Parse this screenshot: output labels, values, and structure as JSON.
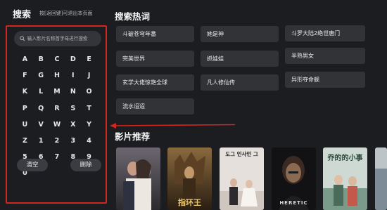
{
  "search": {
    "title": "搜索",
    "hint": "按[返回键]可退出本页面",
    "placeholder": "输入影片名称首字母进行搜索",
    "keys": [
      "A",
      "B",
      "C",
      "D",
      "E",
      "F",
      "G",
      "H",
      "I",
      "J",
      "K",
      "L",
      "M",
      "N",
      "O",
      "P",
      "Q",
      "R",
      "S",
      "T",
      "U",
      "V",
      "W",
      "X",
      "Y",
      "Z",
      "1",
      "2",
      "3",
      "4",
      "5",
      "6",
      "7",
      "8",
      "9",
      "0"
    ],
    "clear_label": "清空",
    "delete_label": "删除"
  },
  "hot": {
    "title": "搜索热词",
    "items": [
      "斗破苍穹年番",
      "她是神",
      "斗罗大陆2绝世唐门",
      "完美世界",
      "抓娃娃",
      "半熟男女",
      "玄学大佬惊艳全球",
      "凡人修仙传",
      "异形夺命舰",
      "流水迢迢"
    ]
  },
  "recommend": {
    "title": "影片推荐",
    "posters": [
      {
        "caption": ""
      },
      {
        "caption": "指环王"
      },
      {
        "caption": "도그 인사인 그"
      },
      {
        "caption": "HERETIC"
      },
      {
        "caption": "乔的的小事"
      },
      {
        "caption": ""
      }
    ]
  },
  "colors": {
    "background": "#1c1d21",
    "highlight_border": "#d2261e",
    "arrow": "#d2261e",
    "button": "#3b3c41",
    "chip": "#323337"
  }
}
